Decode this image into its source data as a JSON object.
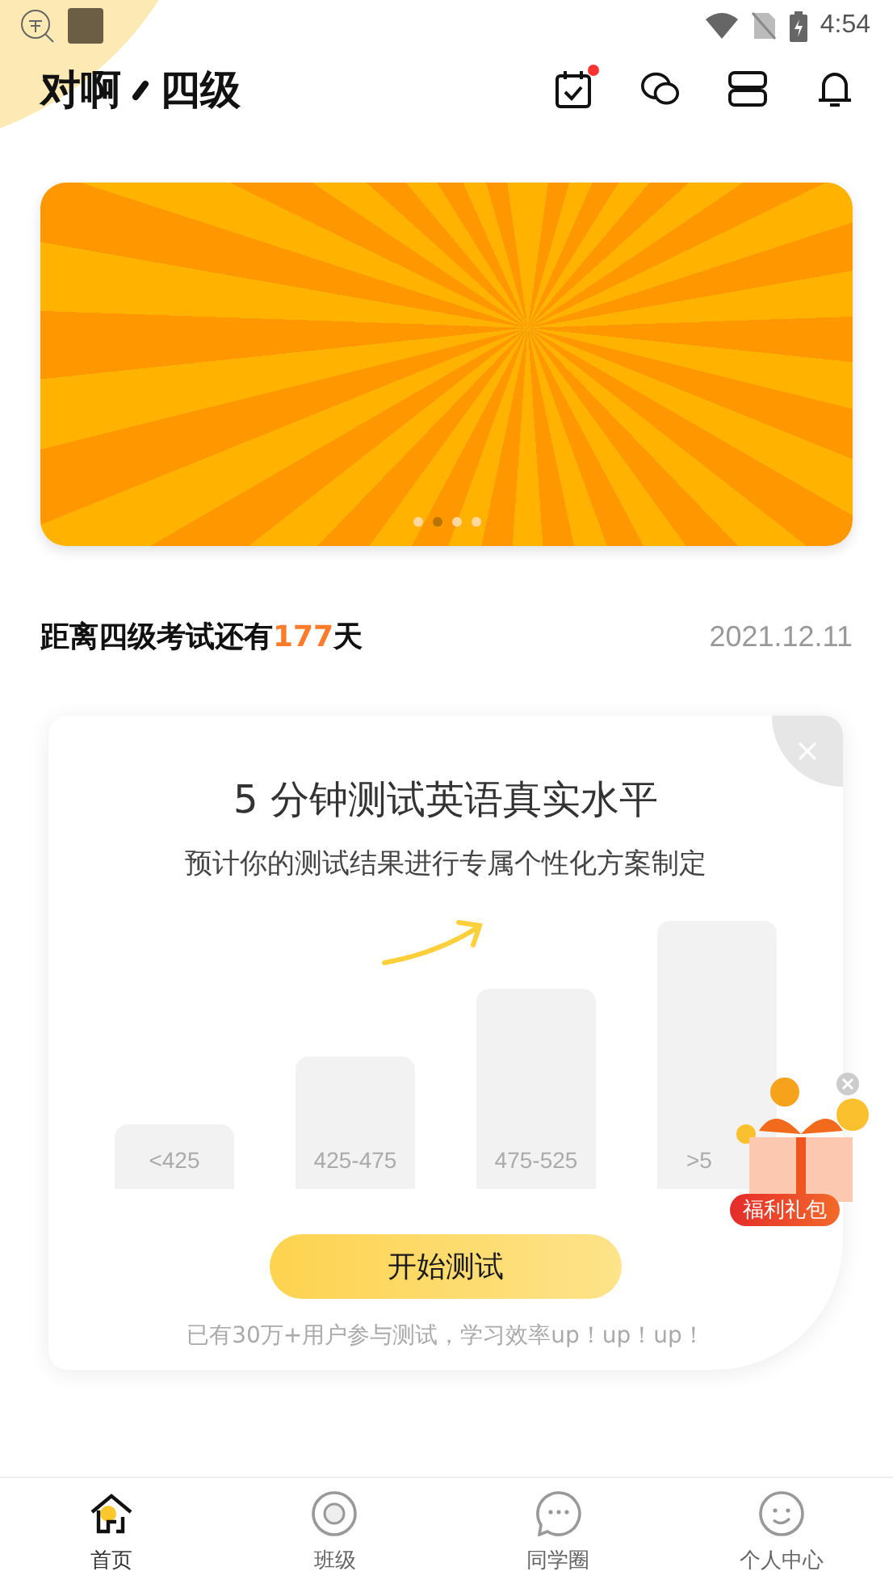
{
  "status_bar": {
    "time": "4:54"
  },
  "header": {
    "title_left": "对啊",
    "title_right": "四级",
    "calendar_badge": true
  },
  "banner": {
    "dots": [
      {
        "selected": false
      },
      {
        "selected": true
      },
      {
        "selected": false
      },
      {
        "selected": false
      }
    ]
  },
  "countdown": {
    "prefix": "距离四级考试还有",
    "days": "177",
    "suffix": "天",
    "date": "2021.12.11"
  },
  "test_card": {
    "title": "5 分钟测试英语真实水平",
    "subtitle": "预计你的测试结果进行专属个性化方案制定",
    "bars": [
      "<425",
      "425-475",
      "475-525",
      ">5"
    ],
    "button": "开始测试",
    "footnote": "已有30万+用户参与测试，学习效率up！up！up！"
  },
  "gift": {
    "label": "福利礼包"
  },
  "tabs": [
    {
      "label": "首页",
      "selected": true
    },
    {
      "label": "班级",
      "selected": false
    },
    {
      "label": "同学圈",
      "selected": false
    },
    {
      "label": "个人中心",
      "selected": false
    }
  ]
}
